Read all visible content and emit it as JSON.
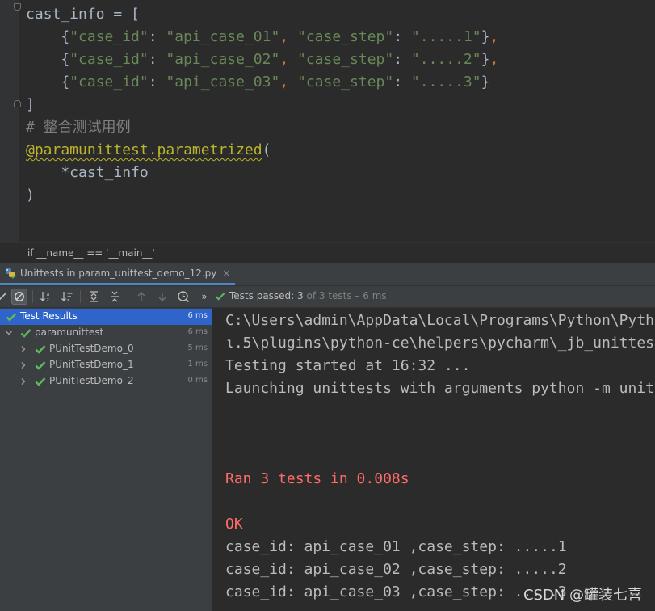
{
  "editor": {
    "lines": [
      [
        {
          "t": "cast_info = [",
          "c": "plain"
        }
      ],
      [
        {
          "t": "    {",
          "c": "plain"
        },
        {
          "t": "\"case_id\"",
          "c": "str"
        },
        {
          "t": ": ",
          "c": "plain"
        },
        {
          "t": "\"api_case_01\"",
          "c": "str"
        },
        {
          "t": ", ",
          "c": "punct"
        },
        {
          "t": "\"case_step\"",
          "c": "str"
        },
        {
          "t": ": ",
          "c": "plain"
        },
        {
          "t": "\".....1\"",
          "c": "str"
        },
        {
          "t": "}",
          "c": "plain"
        },
        {
          "t": ",",
          "c": "punct"
        }
      ],
      [
        {
          "t": "    {",
          "c": "plain"
        },
        {
          "t": "\"case_id\"",
          "c": "str"
        },
        {
          "t": ": ",
          "c": "plain"
        },
        {
          "t": "\"api_case_02\"",
          "c": "str"
        },
        {
          "t": ", ",
          "c": "punct"
        },
        {
          "t": "\"case_step\"",
          "c": "str"
        },
        {
          "t": ": ",
          "c": "plain"
        },
        {
          "t": "\".....2\"",
          "c": "str"
        },
        {
          "t": "}",
          "c": "plain"
        },
        {
          "t": ",",
          "c": "punct"
        }
      ],
      [
        {
          "t": "    {",
          "c": "plain"
        },
        {
          "t": "\"case_id\"",
          "c": "str"
        },
        {
          "t": ": ",
          "c": "plain"
        },
        {
          "t": "\"api_case_03\"",
          "c": "str"
        },
        {
          "t": ", ",
          "c": "punct"
        },
        {
          "t": "\"case_step\"",
          "c": "str"
        },
        {
          "t": ": ",
          "c": "plain"
        },
        {
          "t": "\".....3\"",
          "c": "str"
        },
        {
          "t": "}",
          "c": "plain"
        }
      ],
      [
        {
          "t": "]",
          "c": "plain"
        }
      ],
      [
        {
          "t": "# 整合测试用例",
          "c": "comment"
        }
      ],
      [
        {
          "t": "@paramunittest.parametrized",
          "c": "deco"
        },
        {
          "t": "(",
          "c": "plain"
        }
      ],
      [
        {
          "t": "    *cast_info",
          "c": "plain"
        }
      ],
      [
        {
          "t": ")",
          "c": "plain"
        }
      ]
    ]
  },
  "breadcrumb": {
    "text": "if __name__ == '__main__'"
  },
  "run_panel": {
    "tab_label": "Unittests in param_unittest_demo_12.py",
    "tab_close": "×",
    "status_passed_label": "Tests passed: ",
    "status_passed_count": "3",
    "status_rest": " of 3 tests – 6 ms",
    "toolbar_more": "»"
  },
  "test_tree": {
    "rows": [
      {
        "label": "Test Results",
        "time": "6 ms",
        "level": 0,
        "arrow": "down",
        "selected": true
      },
      {
        "label": "paramunittest",
        "time": "6 ms",
        "level": 1,
        "arrow": "down",
        "selected": false
      },
      {
        "label": "PUnitTestDemo_0",
        "time": "5 ms",
        "level": 2,
        "arrow": "right",
        "selected": false
      },
      {
        "label": "PUnitTestDemo_1",
        "time": "1 ms",
        "level": 2,
        "arrow": "right",
        "selected": false
      },
      {
        "label": "PUnitTestDemo_2",
        "time": "0 ms",
        "level": 2,
        "arrow": "right",
        "selected": false
      }
    ]
  },
  "console": {
    "lines": [
      {
        "text": "C:\\Users\\admin\\AppData\\Local\\Programs\\Python\\Pyth",
        "color": "normal"
      },
      {
        "text": "ι.5\\plugins\\python-ce\\helpers\\pycharm\\_jb_unittes",
        "color": "normal"
      },
      {
        "text": "Testing started at 16:32 ...",
        "color": "normal"
      },
      {
        "text": "Launching unittests with arguments python -m unit",
        "color": "normal"
      },
      {
        "text": "",
        "color": "normal"
      },
      {
        "text": "",
        "color": "normal"
      },
      {
        "text": "",
        "color": "normal"
      },
      {
        "text": "Ran 3 tests in 0.008s",
        "color": "red"
      },
      {
        "text": "",
        "color": "normal"
      },
      {
        "text": "OK",
        "color": "red"
      },
      {
        "text": "case_id: api_case_01 ,case_step: .....1",
        "color": "normal"
      },
      {
        "text": "case_id: api_case_02 ,case_step: .....2",
        "color": "normal"
      },
      {
        "text": "case_id: api_case_03 ,case_step: .....3",
        "color": "normal"
      }
    ]
  },
  "watermark": "CSDN @罐装七喜",
  "colors": {
    "accent": "#4a88c7",
    "pass_green": "#5fb85f",
    "selected_row": "#2f65ca",
    "error_red": "#ff6b68"
  }
}
